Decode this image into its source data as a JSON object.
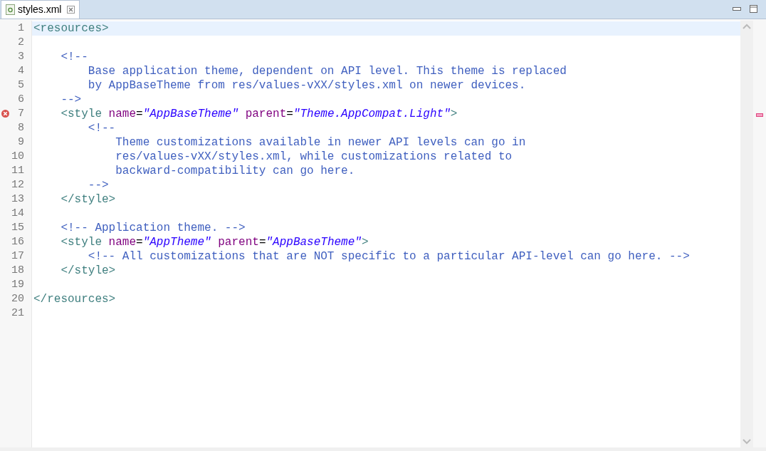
{
  "tab": {
    "title": "styles.xml",
    "selected": true
  },
  "lines": [
    {
      "number": "1",
      "current": true,
      "error": false,
      "tokens": [
        {
          "kind": "tag",
          "text": "<resources>"
        }
      ]
    },
    {
      "number": "2",
      "current": false,
      "error": false
    },
    {
      "number": "3",
      "current": false,
      "error": false,
      "tokens": [
        {
          "kind": "comment",
          "text": "    <!--"
        }
      ]
    },
    {
      "number": "4",
      "current": false,
      "error": false,
      "tokens": [
        {
          "kind": "comment",
          "text": "        Base application theme, dependent on API level. This theme is replaced"
        }
      ]
    },
    {
      "number": "5",
      "current": false,
      "error": false,
      "tokens": [
        {
          "kind": "comment",
          "text": "        by AppBaseTheme from res/values-vXX/styles.xml on newer devices."
        }
      ]
    },
    {
      "number": "6",
      "current": false,
      "error": false,
      "tokens": [
        {
          "kind": "comment",
          "text": "    -->"
        }
      ]
    },
    {
      "number": "7",
      "current": false,
      "error": true,
      "tokens": [
        {
          "kind": "tag",
          "text": "    <style"
        },
        {
          "kind": "attr",
          "text": " name"
        },
        {
          "kind": "eq",
          "text": "="
        },
        {
          "kind": "value",
          "text": "\"AppBaseTheme\""
        },
        {
          "kind": "attr",
          "text": " parent"
        },
        {
          "kind": "eq",
          "text": "="
        },
        {
          "kind": "value",
          "text": "\"Theme.AppCompat.Light\""
        },
        {
          "kind": "tag",
          "text": ">"
        }
      ]
    },
    {
      "number": "8",
      "current": false,
      "error": false,
      "tokens": [
        {
          "kind": "comment",
          "text": "        <!--"
        }
      ]
    },
    {
      "number": "9",
      "current": false,
      "error": false,
      "tokens": [
        {
          "kind": "comment",
          "text": "            Theme customizations available in newer API levels can go in"
        }
      ]
    },
    {
      "number": "10",
      "current": false,
      "error": false,
      "tokens": [
        {
          "kind": "comment",
          "text": "            res/values-vXX/styles.xml, while customizations related to"
        }
      ]
    },
    {
      "number": "11",
      "current": false,
      "error": false,
      "tokens": [
        {
          "kind": "comment",
          "text": "            backward-compatibility can go here."
        }
      ]
    },
    {
      "number": "12",
      "current": false,
      "error": false,
      "tokens": [
        {
          "kind": "comment",
          "text": "        -->"
        }
      ]
    },
    {
      "number": "13",
      "current": false,
      "error": false,
      "tokens": [
        {
          "kind": "tag",
          "text": "    </style>"
        }
      ]
    },
    {
      "number": "14",
      "current": false,
      "error": false
    },
    {
      "number": "15",
      "current": false,
      "error": false,
      "tokens": [
        {
          "kind": "comment",
          "text": "    <!-- Application theme. -->"
        }
      ]
    },
    {
      "number": "16",
      "current": false,
      "error": false,
      "tokens": [
        {
          "kind": "tag",
          "text": "    <style"
        },
        {
          "kind": "attr",
          "text": " name"
        },
        {
          "kind": "eq",
          "text": "="
        },
        {
          "kind": "value",
          "text": "\"AppTheme\""
        },
        {
          "kind": "attr",
          "text": " parent"
        },
        {
          "kind": "eq",
          "text": "="
        },
        {
          "kind": "value",
          "text": "\"AppBaseTheme\""
        },
        {
          "kind": "tag",
          "text": ">"
        }
      ]
    },
    {
      "number": "17",
      "current": false,
      "error": false,
      "tokens": [
        {
          "kind": "comment",
          "text": "        <!-- All customizations that are NOT specific to a particular API-level can go here. -->"
        }
      ]
    },
    {
      "number": "18",
      "current": false,
      "error": false,
      "tokens": [
        {
          "kind": "tag",
          "text": "    </style>"
        }
      ]
    },
    {
      "number": "19",
      "current": false,
      "error": false
    },
    {
      "number": "20",
      "current": false,
      "error": false,
      "tokens": [
        {
          "kind": "tag",
          "text": "</resources>"
        }
      ]
    },
    {
      "number": "21",
      "current": false,
      "error": false
    }
  ]
}
